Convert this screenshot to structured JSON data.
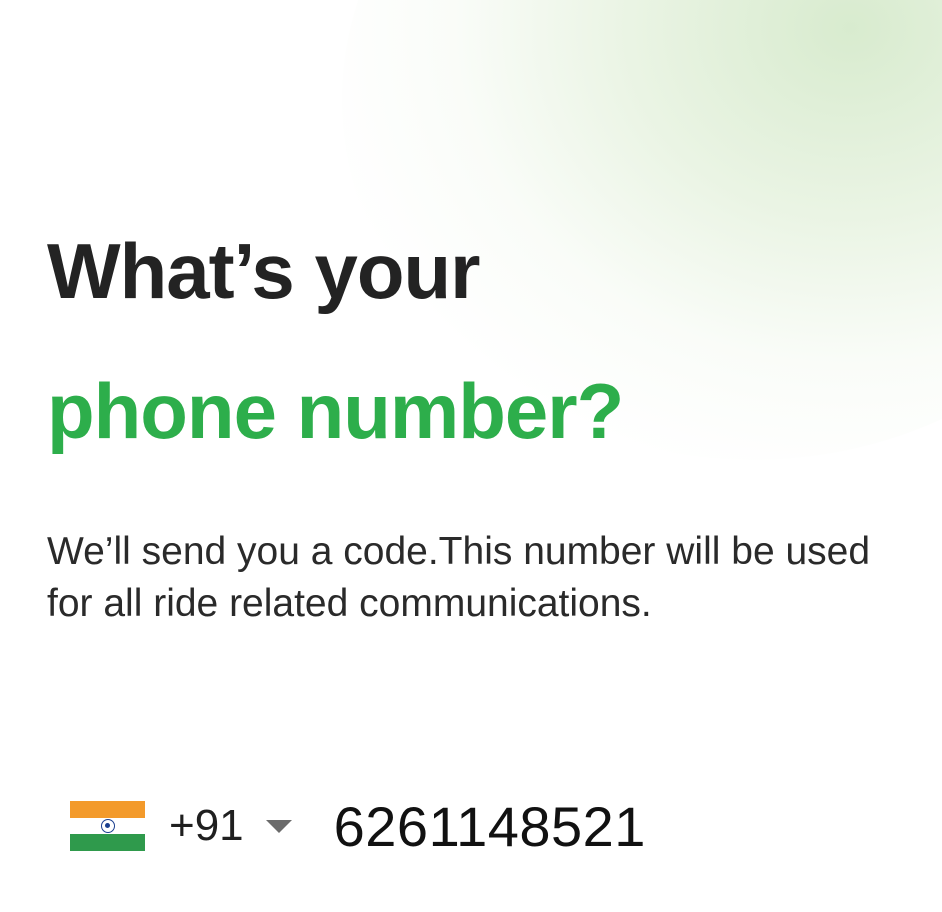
{
  "heading": {
    "line1": "What’s your",
    "line2": "phone number?"
  },
  "subtitle": {
    "line1": "We’ll send you a code.This number will be used",
    "line2": "for all ride related communications."
  },
  "country_picker": {
    "flag_icon": "india-flag-icon",
    "dial_code": "+91",
    "arrow_icon": "caret-down-icon"
  },
  "phone_input": {
    "value": "6261148521"
  },
  "colors": {
    "heading_dark": "#232323",
    "accent_green": "#2dae4b",
    "text": "#2a2a2a"
  }
}
